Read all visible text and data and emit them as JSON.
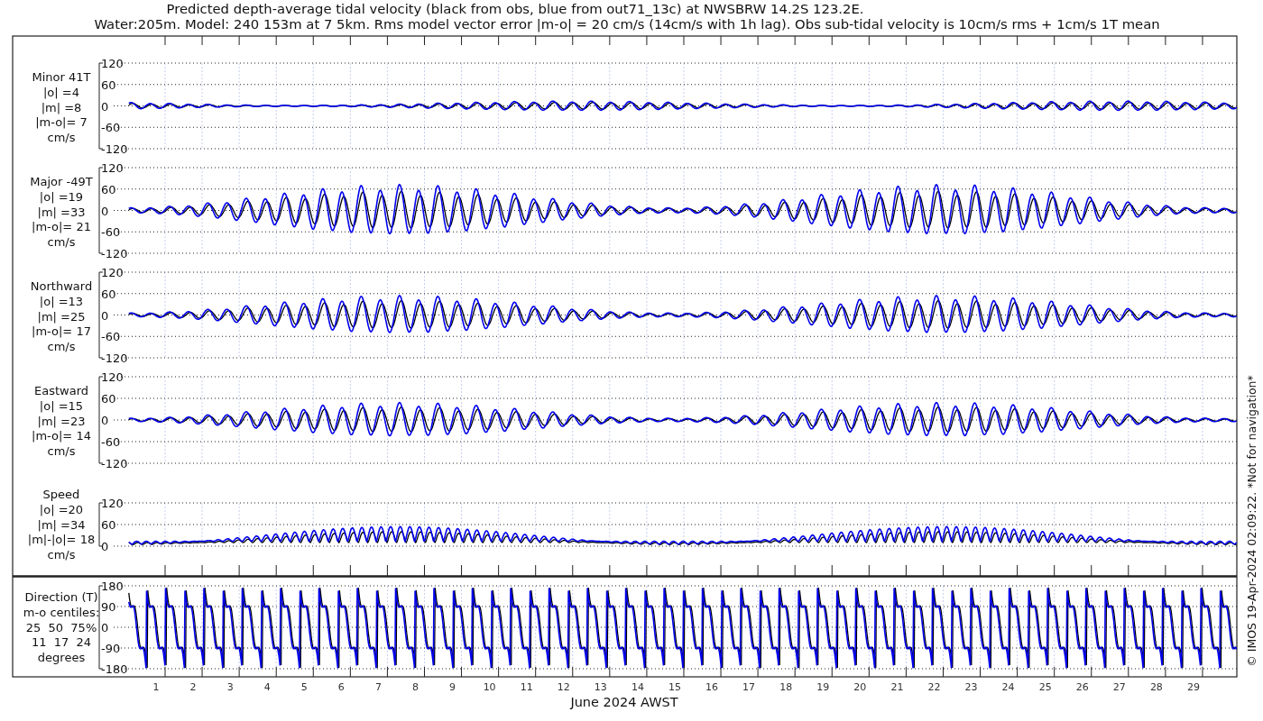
{
  "title_lines": [
    "Predicted depth-average tidal velocity (black from obs, blue from out71_13c) at NWSBRW 14.2S 123.2E.",
    "Water:205m. Model: 240 153m at 7 5km. Rms model vector error |m-o| = 20 cm/s (14cm/s with 1h lag). Obs sub-tidal velocity is 10cm/s rms + 1cm/s 1T mean"
  ],
  "panels": [
    {
      "kind": "velocity",
      "label_lines": [
        "Minor 41T",
        "|o| =4",
        "|m| =8",
        "|m-o|= 7",
        "cm/s"
      ],
      "yticks": [
        "120",
        "60",
        "0",
        "-60",
        "-120"
      ]
    },
    {
      "kind": "velocity",
      "label_lines": [
        "Major -49T",
        "|o| =19",
        "|m| =33",
        "|m-o|= 21",
        "cm/s"
      ],
      "yticks": [
        "120",
        "60",
        "0",
        "-60",
        "-120"
      ]
    },
    {
      "kind": "velocity",
      "label_lines": [
        "Northward",
        "|o| =13",
        "|m| =25",
        "|m-o|= 17",
        "cm/s"
      ],
      "yticks": [
        "120",
        "60",
        "0",
        "-60",
        "-120"
      ]
    },
    {
      "kind": "velocity",
      "label_lines": [
        "Eastward",
        "|o| =15",
        "|m| =23",
        "|m-o|= 14",
        "cm/s"
      ],
      "yticks": [
        "120",
        "60",
        "0",
        "-60",
        "-120"
      ]
    },
    {
      "kind": "speed",
      "label_lines": [
        "Speed",
        "|o| =20",
        "|m| =34",
        "|m|-|o|= 18",
        "cm/s"
      ],
      "yticks": [
        "120",
        "60",
        "0"
      ]
    },
    {
      "kind": "direction",
      "label_lines": [
        "Direction (T)",
        "m-o centiles:",
        "25  50  75%",
        "11  17  24",
        "degrees"
      ],
      "yticks": [
        "180",
        "90",
        "0",
        "-90",
        "-180"
      ]
    }
  ],
  "xticks": [
    "1",
    "2",
    "3",
    "4",
    "5",
    "6",
    "7",
    "8",
    "9",
    "10",
    "11",
    "12",
    "13",
    "14",
    "15",
    "16",
    "17",
    "18",
    "19",
    "20",
    "21",
    "22",
    "23",
    "24",
    "25",
    "26",
    "27",
    "28",
    "29"
  ],
  "xlabel": "June 2024 AWST",
  "side_note": "© IMOS 19-Apr-2024 02:09:22. *Not for navigation*"
}
